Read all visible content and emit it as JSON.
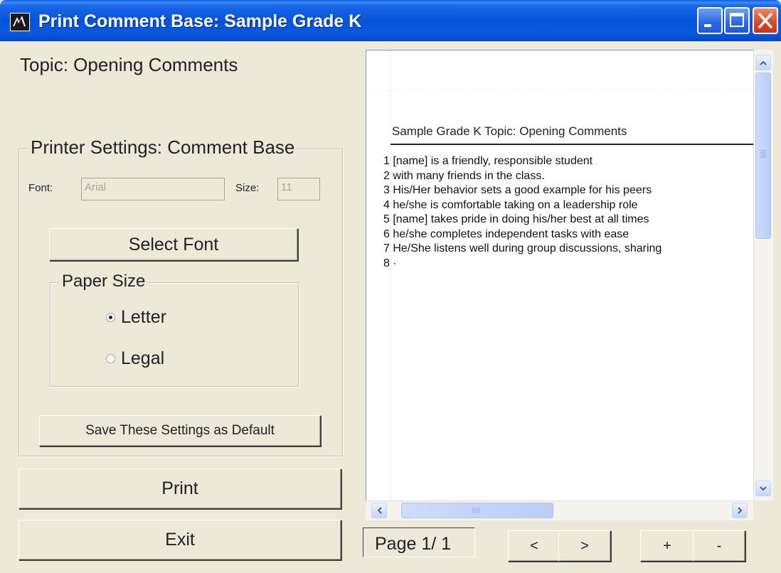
{
  "window": {
    "title": "Print Comment Base: Sample Grade K",
    "controls": {
      "minimize": "minimize-icon",
      "maximize": "maximize-icon",
      "close": "close-icon"
    }
  },
  "topic_label": "Topic: Opening Comments",
  "printer_settings": {
    "legend": "Printer Settings: Comment Base",
    "font_label": "Font:",
    "font_value": "Arial",
    "size_label": "Size:",
    "size_value": "11",
    "select_font_button": "Select Font",
    "paper_size": {
      "legend": "Paper Size",
      "options": [
        {
          "label": "Letter",
          "selected": true
        },
        {
          "label": "Legal",
          "selected": false
        }
      ]
    },
    "save_default_button": "Save These Settings as Default"
  },
  "buttons": {
    "print": "Print",
    "exit": "Exit"
  },
  "preview": {
    "heading": "Sample Grade K  Topic: Opening Comments",
    "lines": [
      "1 [name] is a friendly, responsible student",
      "2 with many friends in the class.",
      "3 His/Her behavior sets a good example for his peers",
      "4 he/she is comfortable taking on a leadership role",
      "5 [name] takes pride in doing his/her best at all times",
      "6 he/she completes independent tasks with ease",
      "7 He/She listens well during group discussions, sharing",
      "8 ·"
    ]
  },
  "pagination": {
    "page_label": "Page 1/ 1",
    "prev_label": "<",
    "next_label": ">",
    "zoom_in_label": "+",
    "zoom_out_label": "-"
  },
  "colors": {
    "titlebar": "#0654dc",
    "window_bg": "#ece9d8",
    "close_button": "#d9442a"
  }
}
